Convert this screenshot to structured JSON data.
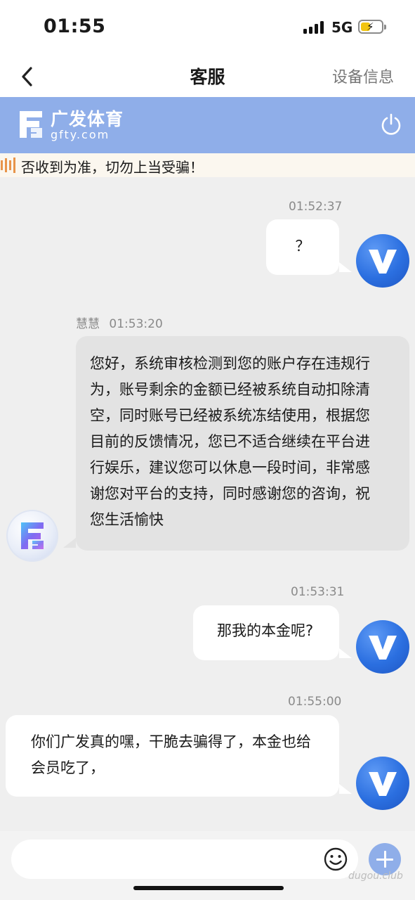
{
  "status_bar": {
    "time": "01:55",
    "network": "5G",
    "battery_percent": 45,
    "icons": [
      "signal-icon",
      "battery-charging-icon"
    ]
  },
  "nav": {
    "title": "客服",
    "right_action": "设备信息",
    "back_icon": "chevron-left-icon"
  },
  "brand": {
    "name": "广发体育",
    "domain": "gfty.com",
    "logo_icon": "gfty-logo-icon",
    "power_icon": "power-icon"
  },
  "notice": {
    "text": "否收到为准，切勿上当受骗！",
    "icon": "speaker-icon"
  },
  "messages": [
    {
      "direction": "out",
      "time": "01:52:37",
      "text": "？"
    },
    {
      "direction": "in",
      "sender": "慧慧",
      "time": "01:53:20",
      "lines": [
        "您好，系统审核检测到您的账户存在违规行",
        "为，账号剩余的金额已经被系统自动扣除清",
        "空，同时账号已经被系统冻结使用，根据您",
        "目前的反馈情况，您已不适合继续在平台进",
        "行娱乐，建议您可以休息一段时间，非常感",
        "谢您对平台的支持，同时感谢您的咨询，祝",
        "您生活愉快"
      ]
    },
    {
      "direction": "out",
      "time": "01:53:31",
      "text": "那我的本金呢?"
    },
    {
      "direction": "out",
      "time": "01:55:00",
      "lines": [
        "你们广发真的嘿，干脆去骗得了，本金也给",
        "会员吃了，"
      ]
    }
  ],
  "input": {
    "placeholder": "",
    "emoji_icon": "smiley-icon",
    "add_icon": "plus-icon"
  },
  "watermark": "dugou.club",
  "colors": {
    "brand": "#8faee9",
    "user_avatar": "#2b6fe0",
    "in_bubble": "#e3e3e3",
    "out_bubble": "#ffffff",
    "background": "#efefef"
  }
}
